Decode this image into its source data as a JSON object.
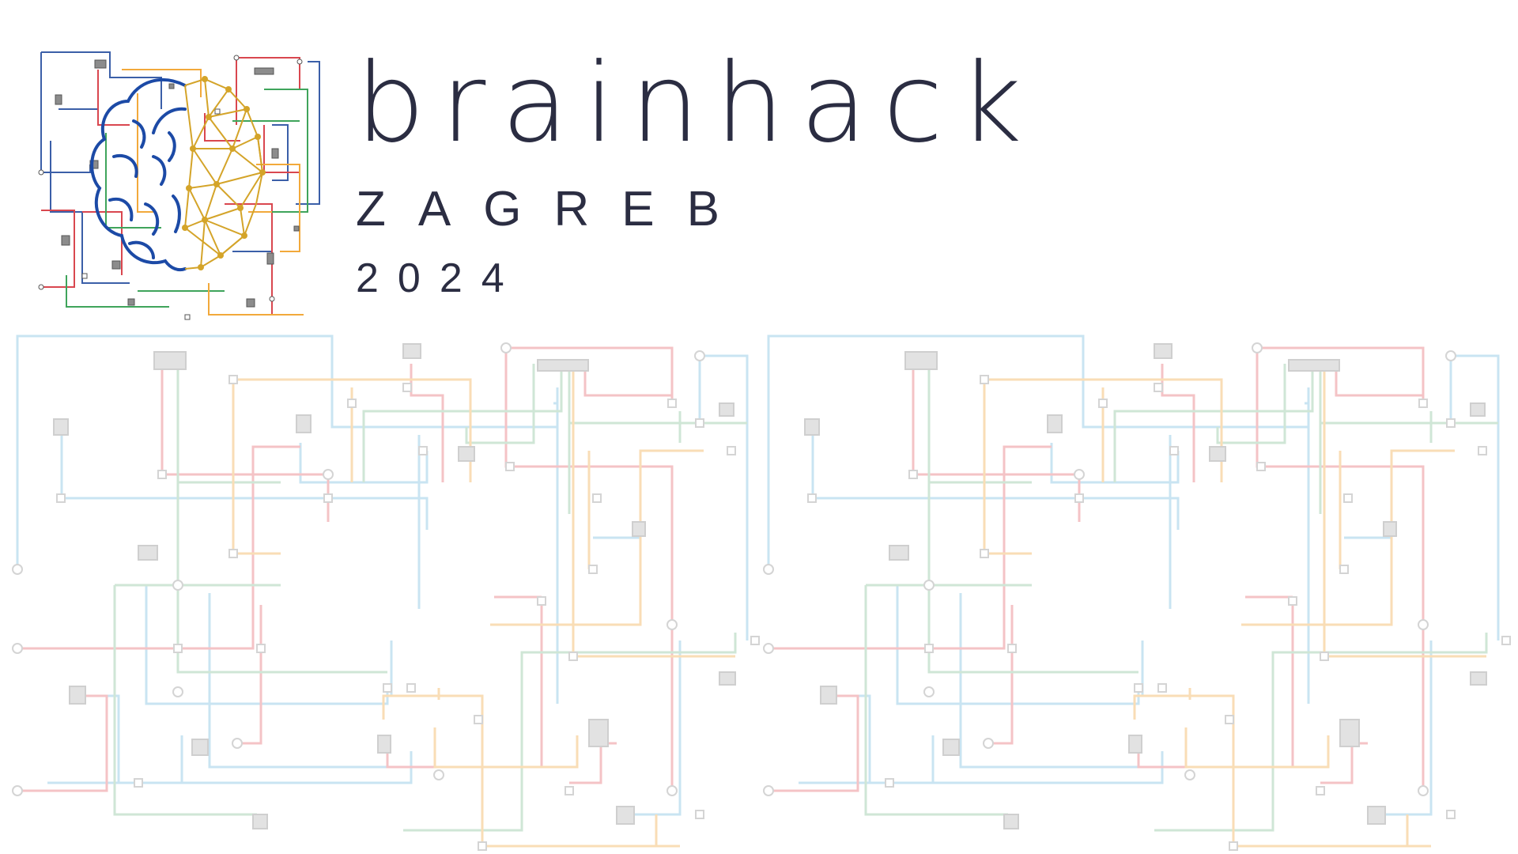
{
  "brand": {
    "name": "brainhack",
    "city": "ZAGREB",
    "year": "2024"
  },
  "colors": {
    "text": "#2b2d42",
    "brain_left": "#1c4aa6",
    "brain_right": "#d4a429",
    "trace_blue": "#3b5fa8",
    "trace_red": "#d9474f",
    "trace_green": "#3fa45b",
    "trace_orange": "#f2a93b",
    "bg_blue": "#c9e4f2",
    "bg_red": "#f4c3c6",
    "bg_green": "#cfe6d6",
    "bg_orange": "#f9ddb6",
    "component": "#cfcfcf"
  },
  "icons": {
    "logo": "brain-circuit-logo",
    "background": "circuit-board-pattern"
  }
}
